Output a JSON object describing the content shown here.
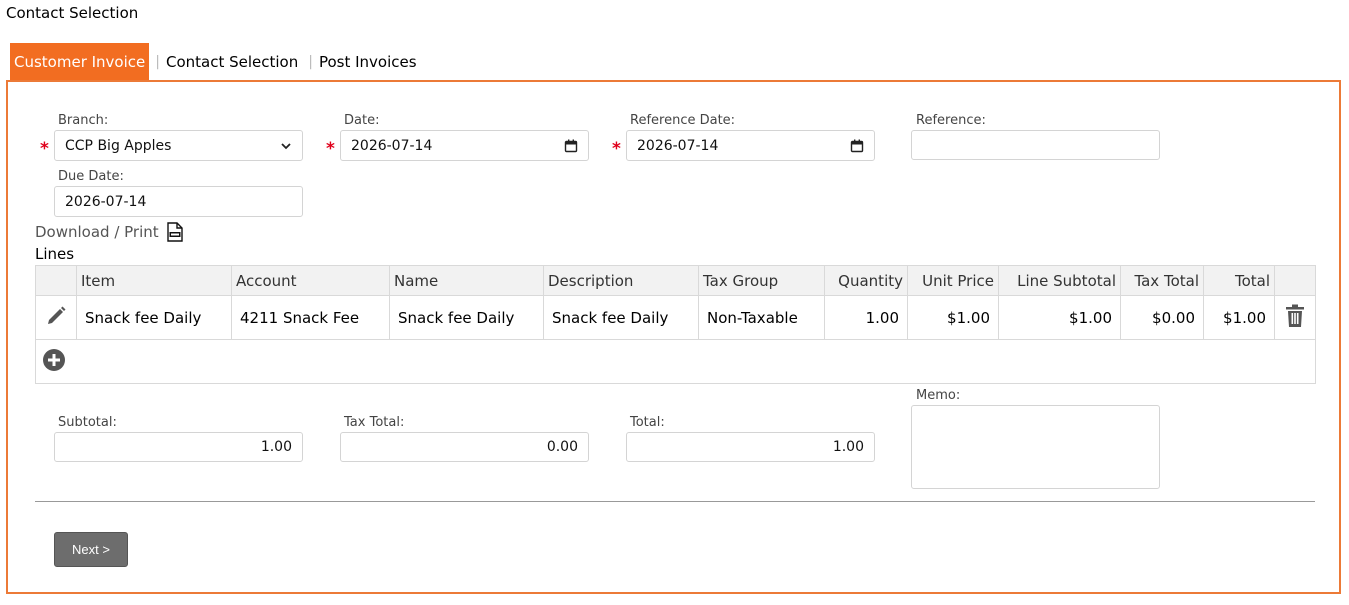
{
  "page": {
    "title": "Contact Selection"
  },
  "tabs": [
    {
      "label": "Customer Invoice",
      "active": true
    },
    {
      "label": "Contact Selection",
      "active": false
    },
    {
      "label": "Post Invoices",
      "active": false
    }
  ],
  "form": {
    "branch": {
      "label": "Branch:",
      "value": "CCP Big Apples",
      "required": true
    },
    "date": {
      "label": "Date:",
      "value": "2026-07-14",
      "required": true
    },
    "reference_date": {
      "label": "Reference Date:",
      "value": "2026-07-14",
      "required": true
    },
    "reference": {
      "label": "Reference:",
      "value": ""
    },
    "due_date": {
      "label": "Due Date:",
      "value": "2026-07-14"
    },
    "required_mark": "*"
  },
  "download": {
    "label": "Download / Print",
    "icon": "csv-file-icon"
  },
  "lines": {
    "label": "Lines",
    "columns": [
      "Item",
      "Account",
      "Name",
      "Description",
      "Tax Group",
      "Quantity",
      "Unit Price",
      "Line Subtotal",
      "Tax Total",
      "Total"
    ],
    "rows": [
      {
        "item": "Snack fee Daily",
        "account": "4211 Snack Fee",
        "name": "Snack fee Daily",
        "description": "Snack fee Daily",
        "tax_group": "Non-Taxable",
        "quantity": "1.00",
        "unit_price": "$1.00",
        "line_subtotal": "$1.00",
        "tax_total": "$0.00",
        "total": "$1.00"
      }
    ]
  },
  "totals": {
    "subtotal": {
      "label": "Subtotal:",
      "value": "1.00"
    },
    "tax_total": {
      "label": "Tax Total:",
      "value": "0.00"
    },
    "total": {
      "label": "Total:",
      "value": "1.00"
    },
    "memo": {
      "label": "Memo:",
      "value": ""
    }
  },
  "actions": {
    "next_label": "Next >"
  },
  "colors": {
    "accent": "#f26d21",
    "required": "#e0001b",
    "button": "#6d6d6d"
  }
}
